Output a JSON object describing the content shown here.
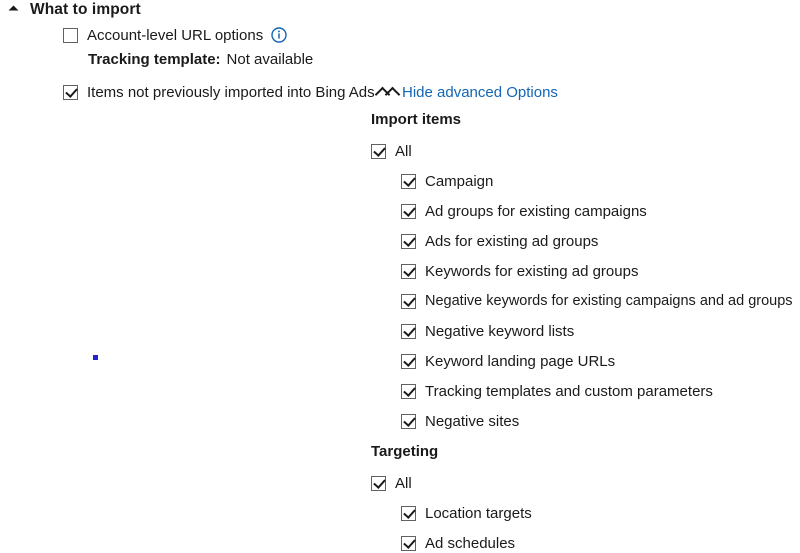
{
  "page": {
    "background_color": "#ffffff",
    "text_color": "#1a1a1a",
    "link_color": "#1266b5",
    "accent_color": "#0078d4"
  },
  "section": {
    "title": "What to import",
    "expander_icon": "triangle-expanded-icon"
  },
  "account_url_options": {
    "label": "Account-level URL options",
    "checked": false,
    "info_icon": "info-circle-icon"
  },
  "tracking_template": {
    "label": "Tracking template:",
    "value": "Not available"
  },
  "items_not_imported": {
    "label": "Items not previously imported into Bing Ads",
    "checked": true,
    "chevron_icon": "chevron-up-icon"
  },
  "advanced_options_link": {
    "label": "Hide advanced Options",
    "chevron_icon": "chevron-up-icon"
  },
  "import_items": {
    "heading": "Import items",
    "all": {
      "label": "All",
      "checked": true
    },
    "items": [
      {
        "label": "Campaign",
        "checked": true
      },
      {
        "label": "Ad groups for existing campaigns",
        "checked": true
      },
      {
        "label": "Ads for existing ad groups",
        "checked": true
      },
      {
        "label": "Keywords for existing ad groups",
        "checked": true
      },
      {
        "label": "Negative keywords for existing campaigns and ad groups",
        "checked": true
      },
      {
        "label": "Negative keyword lists",
        "checked": true
      },
      {
        "label": "Keyword landing page URLs",
        "checked": true
      },
      {
        "label": "Tracking templates and custom parameters",
        "checked": true
      },
      {
        "label": "Negative sites",
        "checked": true
      }
    ]
  },
  "targeting": {
    "heading": "Targeting",
    "all": {
      "label": "All",
      "checked": true
    },
    "items": [
      {
        "label": "Location targets",
        "checked": true
      },
      {
        "label": "Ad schedules",
        "checked": true
      }
    ]
  },
  "cursor_marker": {
    "name": "blue-dot-marker",
    "color": "#2323c8"
  }
}
